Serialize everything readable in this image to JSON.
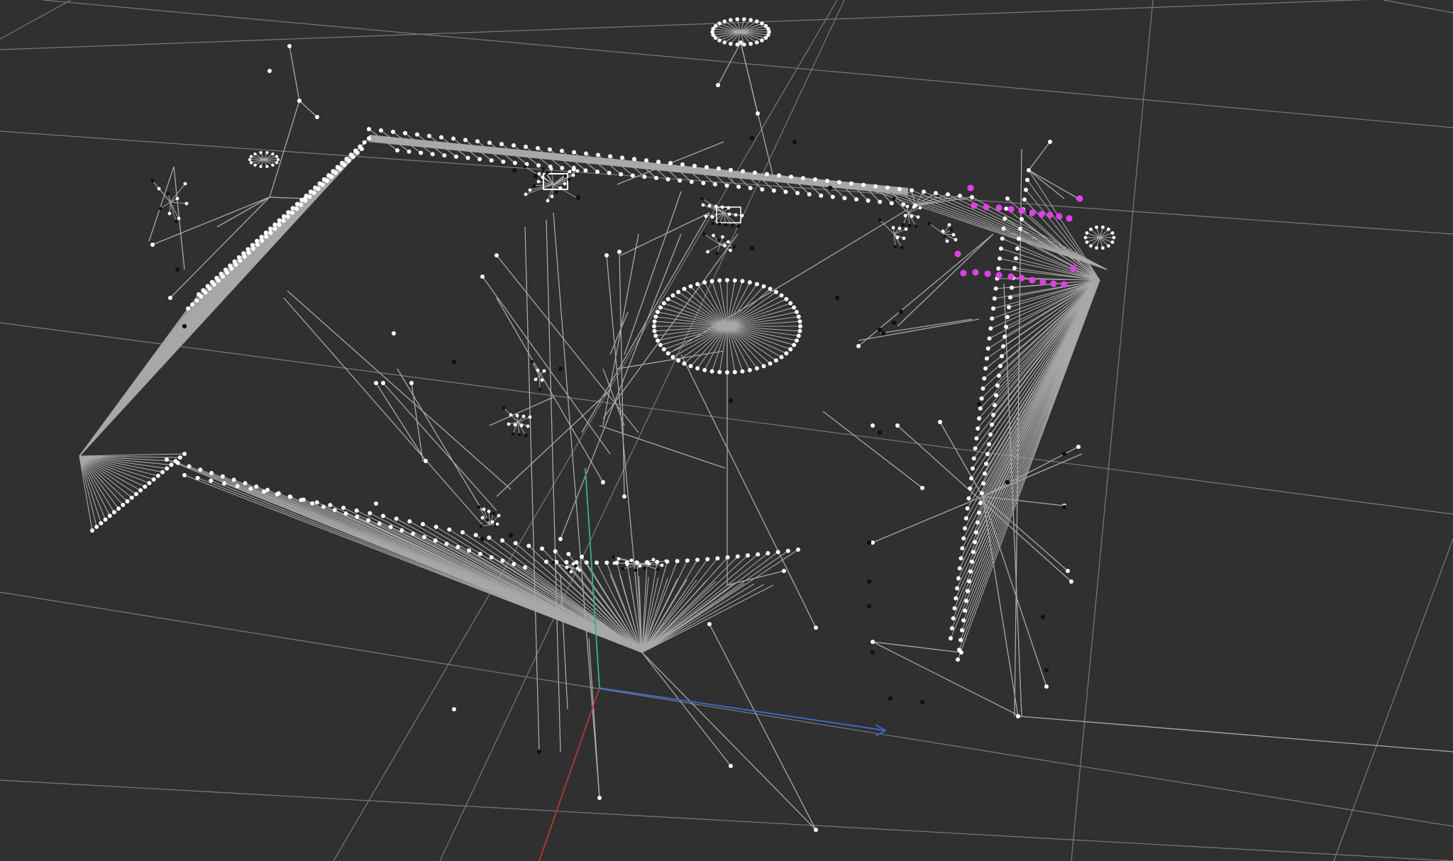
{
  "viewport": {
    "background": "#303030",
    "grid_color": "#7a7a7a",
    "edge_color": "#a8a8a8",
    "node_color": "#ffffff",
    "dark_node_color": "#111111",
    "highlight_color": "#e040e8"
  },
  "axes": {
    "x_axis_color": "#3a6fd0",
    "y_axis_color": "#3cb371",
    "z_axis_color": "#b03a3a"
  },
  "scene": {
    "description_label": "",
    "highlighted_nodes": 22,
    "ring_clusters": 4
  }
}
